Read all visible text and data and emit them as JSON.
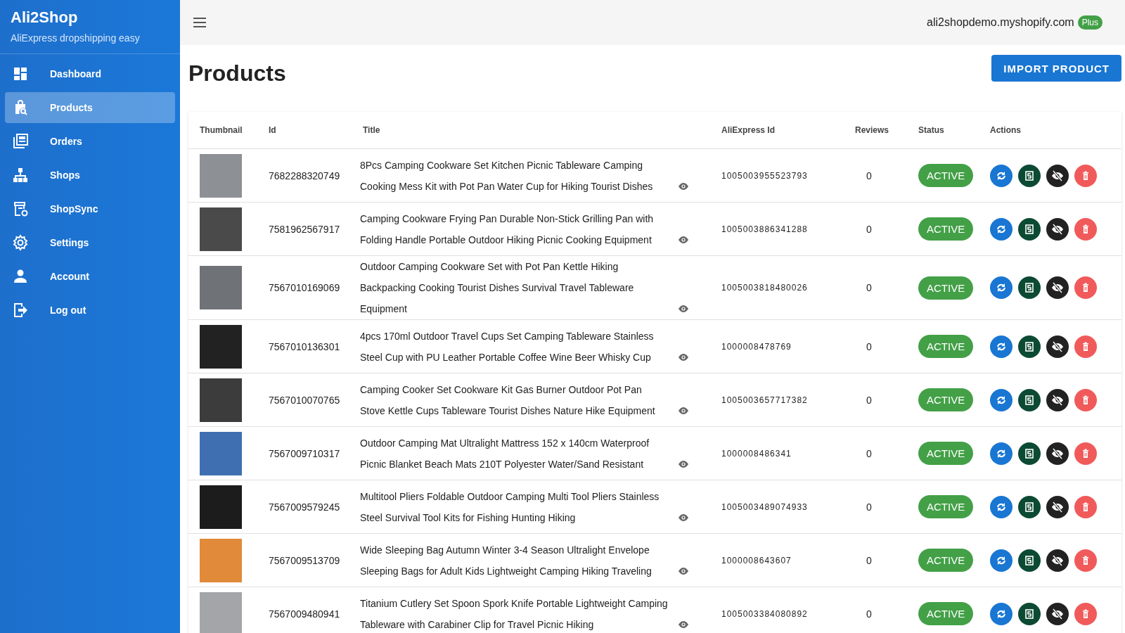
{
  "sidebar": {
    "brand": "Ali2Shop",
    "tagline": "AliExpress dropshipping easy",
    "items": [
      {
        "label": "Dashboard",
        "selected": false
      },
      {
        "label": "Products",
        "selected": true
      },
      {
        "label": "Orders",
        "selected": false
      },
      {
        "label": "Shops",
        "selected": false
      },
      {
        "label": "ShopSync",
        "selected": false
      },
      {
        "label": "Settings",
        "selected": false
      },
      {
        "label": "Account",
        "selected": false
      },
      {
        "label": "Log out",
        "selected": false
      }
    ]
  },
  "topbar": {
    "store": "ali2shopdemo.myshopify.com",
    "plan_badge": "Plus"
  },
  "page": {
    "title": "Products",
    "import_button": "IMPORT PRODUCT"
  },
  "table": {
    "columns": [
      "Thumbnail",
      "Id",
      "Title",
      "AliExpress Id",
      "Reviews",
      "Status",
      "Actions"
    ],
    "rows": [
      {
        "id": "7682288320749",
        "title": "8Pcs Camping Cookware Set Kitchen Picnic Tableware Camping Cooking Mess Kit with Pot Pan Water Cup for Hiking Tourist Dishes",
        "aliexpress_id": "1005003955523793",
        "reviews": "0",
        "status": "ACTIVE"
      },
      {
        "id": "7581962567917",
        "title": "Camping Cookware Frying Pan Durable Non-Stick Grilling Pan with Folding Handle Portable Outdoor Hiking Picnic Cooking Equipment",
        "aliexpress_id": "1005003886341288",
        "reviews": "0",
        "status": "ACTIVE"
      },
      {
        "id": "7567010169069",
        "title": "Outdoor Camping Cookware Set with Pot Pan Kettle Hiking Backpacking Cooking Tourist Dishes Survival Travel Tableware Equipment",
        "aliexpress_id": "1005003818480026",
        "reviews": "0",
        "status": "ACTIVE"
      },
      {
        "id": "7567010136301",
        "title": "4pcs 170ml Outdoor Travel Cups Set Camping Tableware Stainless Steel Cup with PU Leather Portable Coffee Wine Beer Whisky Cup",
        "aliexpress_id": "1000008478769",
        "reviews": "0",
        "status": "ACTIVE"
      },
      {
        "id": "7567010070765",
        "title": "Camping Cooker Set Cookware Kit Gas Burner Outdoor Pot Pan Stove Kettle Cups Tableware Tourist Dishes Nature Hike Equipment",
        "aliexpress_id": "1005003657717382",
        "reviews": "0",
        "status": "ACTIVE"
      },
      {
        "id": "7567009710317",
        "title": "Outdoor Camping Mat Ultralight Mattress 152 x 140cm Waterproof Picnic Blanket Beach Mats 210T Polyester Water/Sand Resistant",
        "aliexpress_id": "1000008486341",
        "reviews": "0",
        "status": "ACTIVE"
      },
      {
        "id": "7567009579245",
        "title": "Multitool Pliers Foldable Outdoor Camping Multi Tool Pliers Stainless Steel Survival Tool Kits for Fishing Hunting Hiking",
        "aliexpress_id": "1005003489074933",
        "reviews": "0",
        "status": "ACTIVE"
      },
      {
        "id": "7567009513709",
        "title": "Wide Sleeping Bag Autumn Winter 3-4 Season Ultralight Envelope Sleeping Bags for Adult Kids Lightweight Camping Hiking Traveling",
        "aliexpress_id": "1000008643607",
        "reviews": "0",
        "status": "ACTIVE"
      },
      {
        "id": "7567009480941",
        "title": "Titanium Cutlery Set Spoon Spork Knife Portable Lightweight Camping Tableware with Carabiner Clip for Travel Picnic Hiking",
        "aliexpress_id": "1005003384080892",
        "reviews": "0",
        "status": "ACTIVE"
      }
    ]
  }
}
